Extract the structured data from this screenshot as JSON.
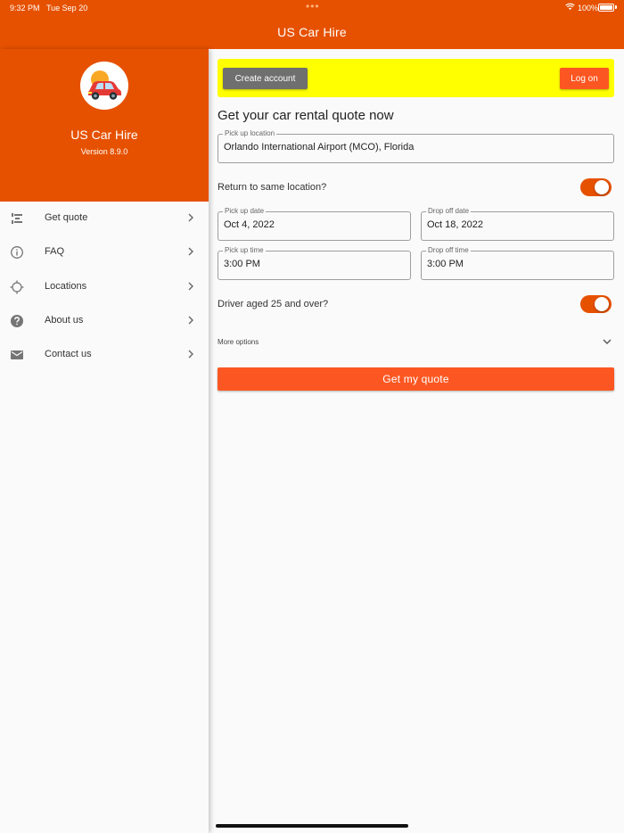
{
  "status_bar": {
    "time": "9:32 PM",
    "date": "Tue Sep 20",
    "battery": "100%"
  },
  "app_bar": {
    "title": "US Car Hire"
  },
  "drawer": {
    "app_name": "US Car Hire",
    "version": "Version 8.9.0",
    "items": [
      {
        "label": "Get quote",
        "icon": "quote-icon"
      },
      {
        "label": "FAQ",
        "icon": "info-icon"
      },
      {
        "label": "Locations",
        "icon": "gps-icon"
      },
      {
        "label": "About us",
        "icon": "help-icon"
      },
      {
        "label": "Contact us",
        "icon": "mail-icon"
      }
    ]
  },
  "account_banner": {
    "create_label": "Create account",
    "logon_label": "Log on"
  },
  "form": {
    "heading": "Get your car rental quote now",
    "pickup_location": {
      "label": "Pick up location",
      "value": "Orlando International Airport (MCO), Florida"
    },
    "return_same": {
      "label": "Return to same location?",
      "on": true
    },
    "pickup_date": {
      "label": "Pick up date",
      "value": "Oct 4, 2022"
    },
    "dropoff_date": {
      "label": "Drop off date",
      "value": "Oct 18, 2022"
    },
    "pickup_time": {
      "label": "Pick up time",
      "value": "3:00 PM"
    },
    "dropoff_time": {
      "label": "Drop off time",
      "value": "3:00 PM"
    },
    "driver_age": {
      "label": "Driver aged 25 and over?",
      "on": true
    },
    "more_options": "More options",
    "submit_label": "Get my quote"
  },
  "colors": {
    "primary": "#e65100",
    "accent": "#fc5722",
    "banner": "#ffff00",
    "secondary_button": "#6f6f6f"
  }
}
